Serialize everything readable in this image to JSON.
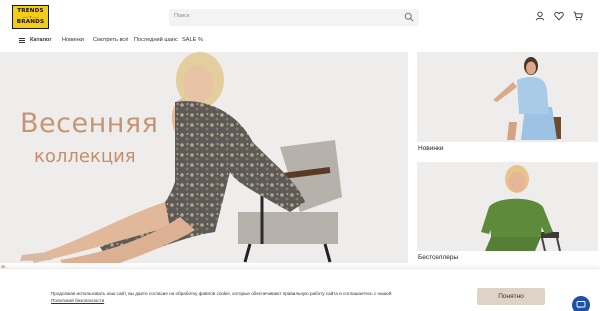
{
  "header": {
    "logo": {
      "line1": "TRENDS",
      "line2": "BRANDS",
      "mid": "—— ✦ ——"
    },
    "search": {
      "placeholder": "Поиск"
    },
    "icons": [
      "user-icon",
      "heart-icon",
      "cart-icon"
    ]
  },
  "nav": {
    "catalog": "Каталог",
    "items": [
      "Новинки",
      "Смотреть всё",
      "Последний шанс",
      "SALE %"
    ]
  },
  "hero": {
    "title": "Весенняя",
    "subtitle": "коллекция"
  },
  "cards": [
    {
      "label": "Новинки"
    },
    {
      "label": "Бестселлеры"
    }
  ],
  "cookie": {
    "text": "Продолжая использовать наш сайт, вы даете согласие на обработку файлов cookie, которые обеспечивают правильную работу сайта и соглашаетесь с нашей",
    "link": "Политикой безопасности",
    "button": "Понятно"
  },
  "colors": {
    "logo_bg": "#f4cc1a",
    "hero_text": "#c69573",
    "cookie_button": "#dfd3c8",
    "chat_button": "#1e50a8"
  }
}
